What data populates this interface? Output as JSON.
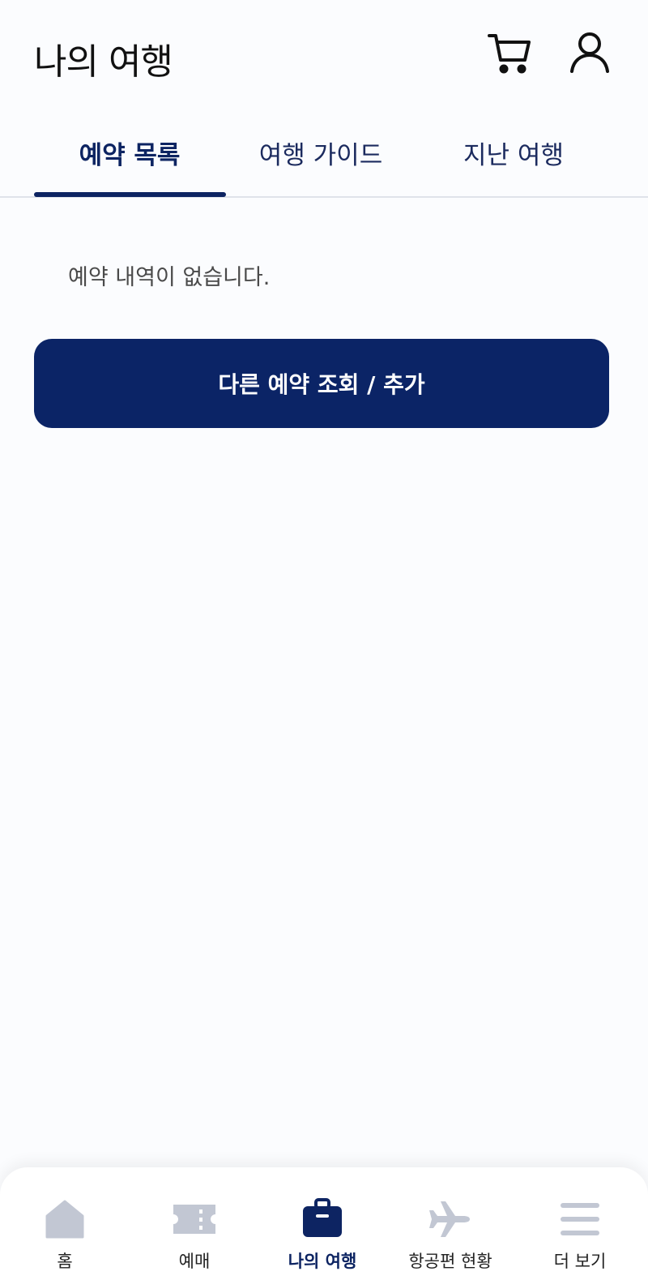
{
  "header": {
    "title": "나의 여행",
    "cart_icon": "cart-icon",
    "user_icon": "user-icon"
  },
  "tabs": [
    {
      "label": "예약 목록",
      "active": true
    },
    {
      "label": "여행 가이드",
      "active": false
    },
    {
      "label": "지난 여행",
      "active": false
    }
  ],
  "content": {
    "empty_message": "예약 내역이 없습니다.",
    "primary_button_label": "다른 예약 조회 / 추가"
  },
  "bottom_nav": [
    {
      "label": "홈",
      "icon": "home-icon",
      "active": false
    },
    {
      "label": "예매",
      "icon": "ticket-icon",
      "active": false
    },
    {
      "label": "나의 여행",
      "icon": "briefcase-icon",
      "active": true
    },
    {
      "label": "항공편 현황",
      "icon": "airplane-icon",
      "active": false
    },
    {
      "label": "더 보기",
      "icon": "menu-icon",
      "active": false
    }
  ],
  "colors": {
    "brand_navy": "#0b2466",
    "inactive_icon": "#c2c7d3",
    "background": "#fbfcfe"
  }
}
